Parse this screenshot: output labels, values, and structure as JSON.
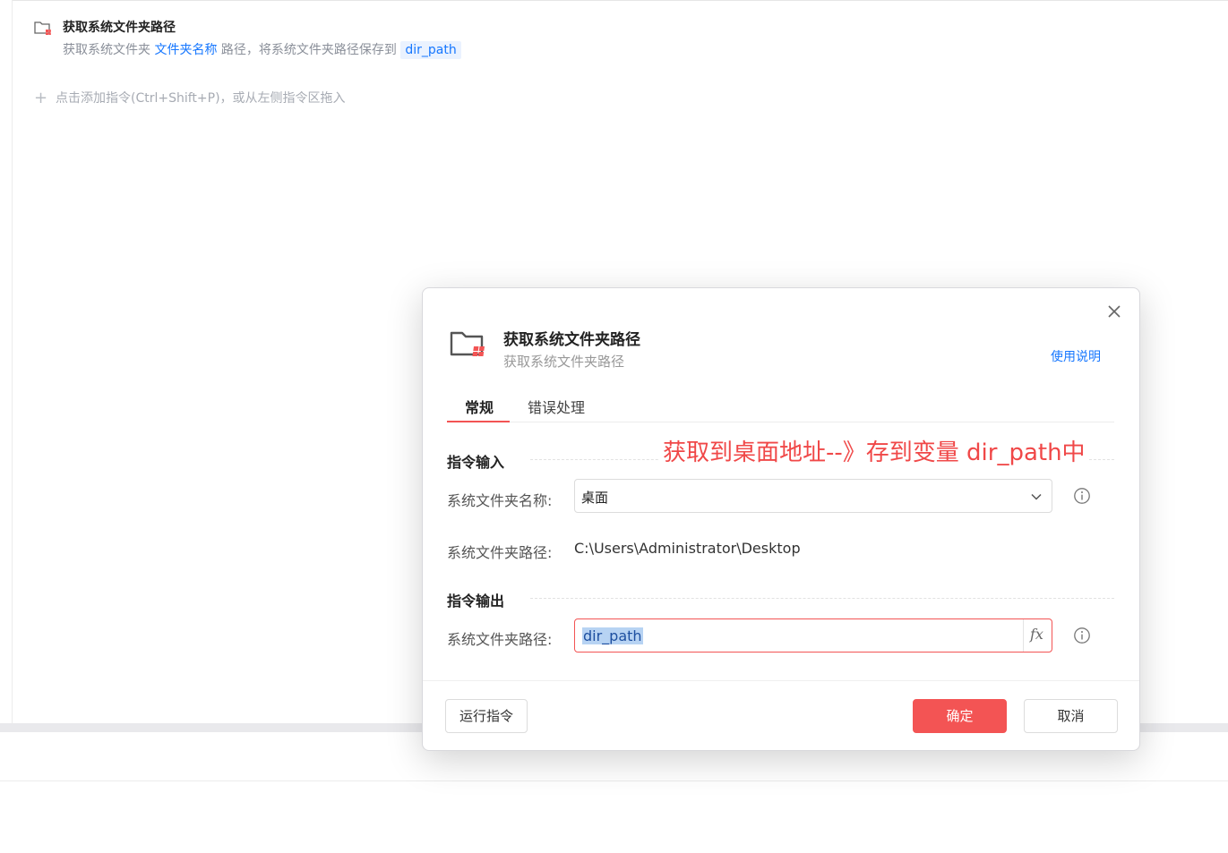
{
  "workspace": {
    "command": {
      "title": "获取系统文件夹路径",
      "desc_prefix": "获取系统文件夹",
      "desc_param": "文件夹名称",
      "desc_middle": "路径，将系统文件夹路径保存到",
      "desc_var": "dir_path"
    },
    "add_hint": "点击添加指令(Ctrl+Shift+P)，或从左侧指令区拖入"
  },
  "dialog": {
    "title": "获取系统文件夹路径",
    "subtitle": "获取系统文件夹路径",
    "help_link": "使用说明",
    "tabs": [
      {
        "label": "常规",
        "active": true
      },
      {
        "label": "错误处理",
        "active": false
      }
    ],
    "input_section": {
      "heading": "指令输入",
      "folder_name_label": "系统文件夹名称:",
      "folder_name_value": "桌面",
      "folder_path_label": "系统文件夹路径:",
      "folder_path_value": "C:\\Users\\Administrator\\Desktop"
    },
    "annotation": "获取到桌面地址--》存到变量 dir_path中",
    "output_section": {
      "heading": "指令输出",
      "output_label": "系统文件夹路径:",
      "output_value": "dir_path",
      "fx_label": "fx"
    },
    "buttons": {
      "run": "运行指令",
      "ok": "确定",
      "cancel": "取消"
    }
  },
  "colors": {
    "accent": "#f35454",
    "link": "#1677ff",
    "annotation": "#f04848"
  }
}
